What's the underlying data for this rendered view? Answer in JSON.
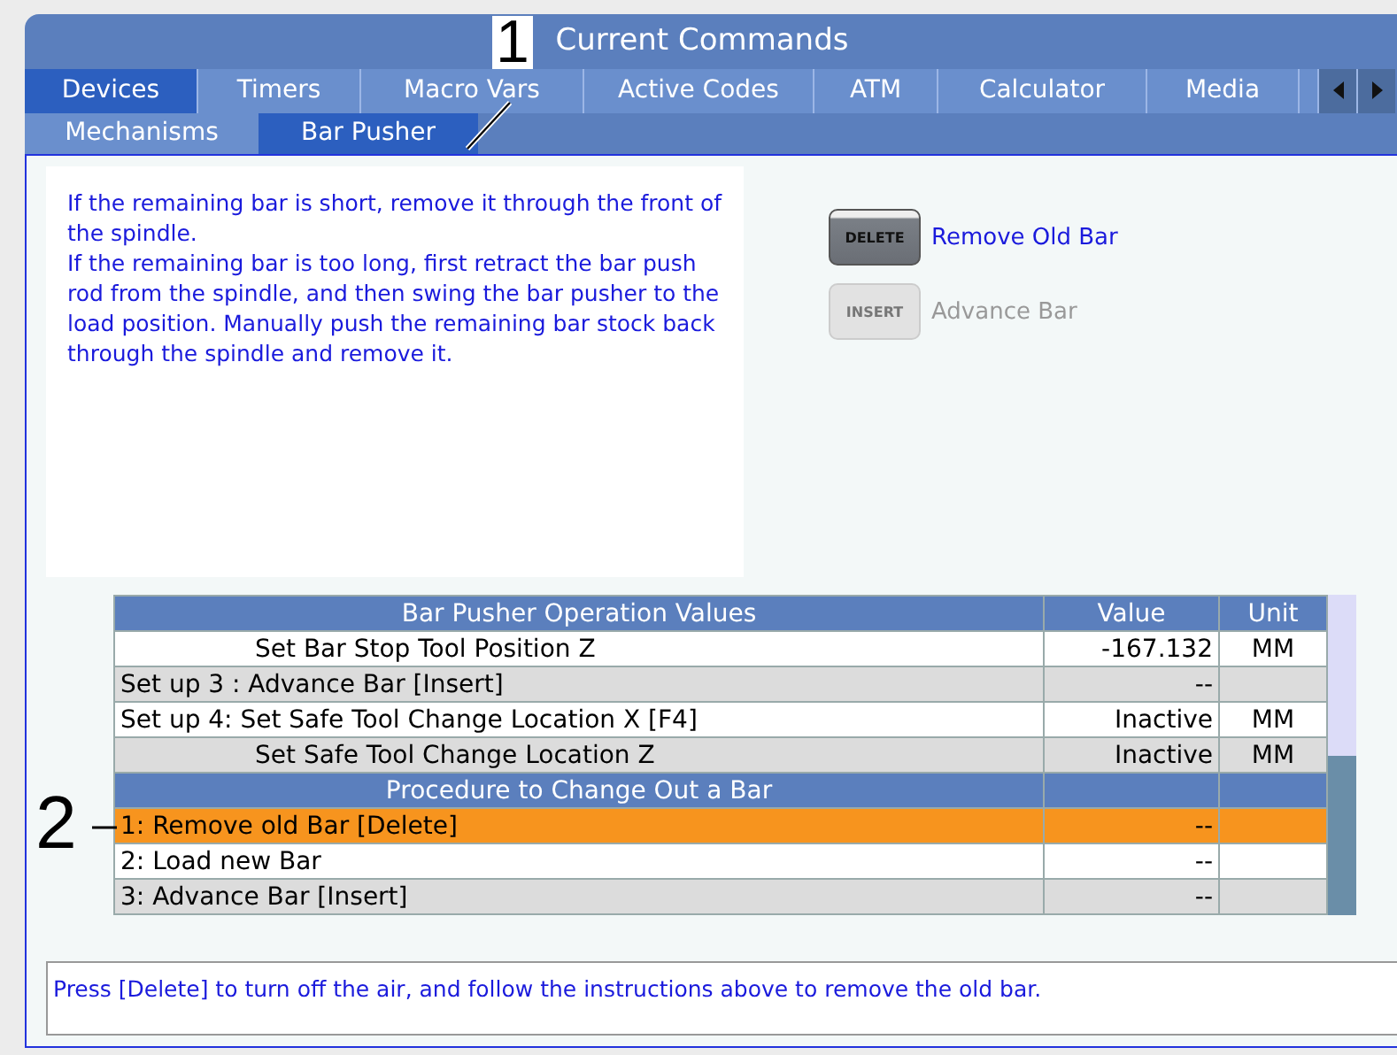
{
  "window": {
    "title": "Current Commands"
  },
  "tabs": [
    {
      "label": "Devices",
      "selected": true
    },
    {
      "label": "Timers",
      "selected": false
    },
    {
      "label": "Macro Vars",
      "selected": false
    },
    {
      "label": "Active Codes",
      "selected": false
    },
    {
      "label": "ATM",
      "selected": false
    },
    {
      "label": "Calculator",
      "selected": false
    },
    {
      "label": "Media",
      "selected": false
    }
  ],
  "subtabs": [
    {
      "label": "Mechanisms",
      "selected": false
    },
    {
      "label": "Bar Pusher",
      "selected": true
    }
  ],
  "instructions": [
    "If the remaining bar is short, remove it through the front of the spindle.",
    "If the remaining bar is too long, first retract the bar push rod from the spindle, and then swing the bar pusher to the load position. Manually push the remaining bar stock back through the spindle and remove it."
  ],
  "keys": [
    {
      "key": "DELETE",
      "label": "Remove Old Bar",
      "disabled": false
    },
    {
      "key": "INSERT",
      "label": "Advance Bar",
      "disabled": true
    }
  ],
  "table": {
    "columns": [
      "Bar Pusher Operation Values",
      "Value",
      "Unit"
    ],
    "rows": [
      {
        "kind": "row",
        "cells": [
          "Set Bar Stop Tool Position Z",
          "-167.132",
          "MM"
        ],
        "indented": true,
        "selected": false
      },
      {
        "kind": "row",
        "cells": [
          "Set up 3 : Advance Bar [Insert]",
          "--",
          ""
        ],
        "indented": false,
        "selected": false
      },
      {
        "kind": "row",
        "cells": [
          "Set up 4: Set Safe Tool Change Location X [F4]",
          "Inactive",
          "MM"
        ],
        "indented": false,
        "selected": false
      },
      {
        "kind": "row",
        "cells": [
          "Set Safe Tool Change Location Z",
          "Inactive",
          "MM"
        ],
        "indented": true,
        "selected": false
      },
      {
        "kind": "header",
        "cells": [
          "Procedure to Change Out a Bar"
        ]
      },
      {
        "kind": "row",
        "cells": [
          "1: Remove old Bar [Delete]",
          "--",
          ""
        ],
        "indented": false,
        "selected": true
      },
      {
        "kind": "row",
        "cells": [
          "2: Load new Bar",
          "--",
          ""
        ],
        "indented": false,
        "selected": false
      },
      {
        "kind": "row",
        "cells": [
          "3: Advance Bar [Insert]",
          "--",
          ""
        ],
        "indented": false,
        "selected": false
      }
    ]
  },
  "message": "Press [Delete] to turn off the air, and follow the instructions above to remove the old bar.",
  "callouts": [
    "1",
    "2"
  ]
}
